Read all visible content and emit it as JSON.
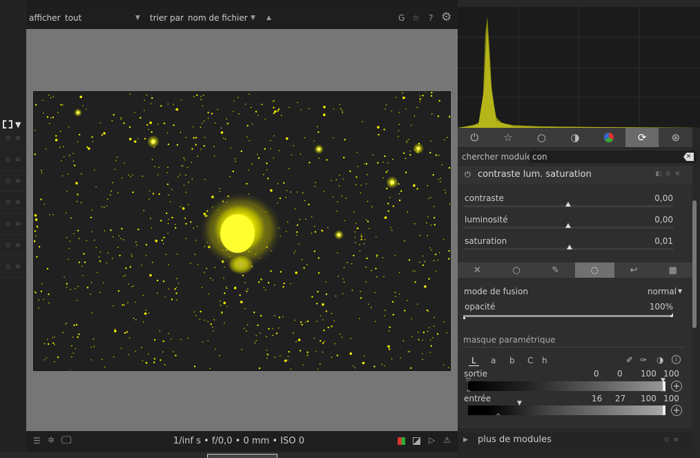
{
  "topbar": {
    "show_label": "afficher",
    "show_value": "tout",
    "sort_label": "trier par",
    "sort_value": "nom de fichier",
    "g_label": "G"
  },
  "bottombar": {
    "info": "1/inf s • f/0,0 • 0 mm • ISO 0"
  },
  "right_panel": {
    "search_label": "chercher module",
    "search_value": "con",
    "module_title": "contraste lum. saturation",
    "sliders": [
      {
        "label": "contraste",
        "value": "0,00",
        "position": 0.5
      },
      {
        "label": "luminosité",
        "value": "0,00",
        "position": 0.5
      },
      {
        "label": "saturation",
        "value": "0,01",
        "position": 0.505
      }
    ],
    "blend_mode_label": "mode de fusion",
    "blend_mode_value": "normal",
    "opacity_label": "opacité",
    "opacity_value": "100%",
    "opacity_level": 1.0,
    "mask_section": "masque paramétrique",
    "channels": [
      "L",
      "a",
      "b",
      "C",
      "h"
    ],
    "active_channel": "L",
    "output_label": "sortie",
    "output_values": [
      "0",
      "0",
      "100",
      "100"
    ],
    "input_label": "entrée",
    "input_values": [
      "16",
      "27",
      "100",
      "100"
    ],
    "more_modules": "plus de modules"
  },
  "icons": {
    "groups": [
      "power-icon",
      "star-icon",
      "circle-icon",
      "half-circle-icon",
      "color-circle-icon",
      "refresh-icon",
      "aperture-icon"
    ],
    "blend": [
      "off-icon",
      "uniform-icon",
      "drawn-icon",
      "parametric-icon",
      "drawn-parametric-icon",
      "raster-icon"
    ]
  },
  "colors": {
    "accent_yellow": "#f2f200",
    "histogram_fill": "#8a8a10"
  }
}
